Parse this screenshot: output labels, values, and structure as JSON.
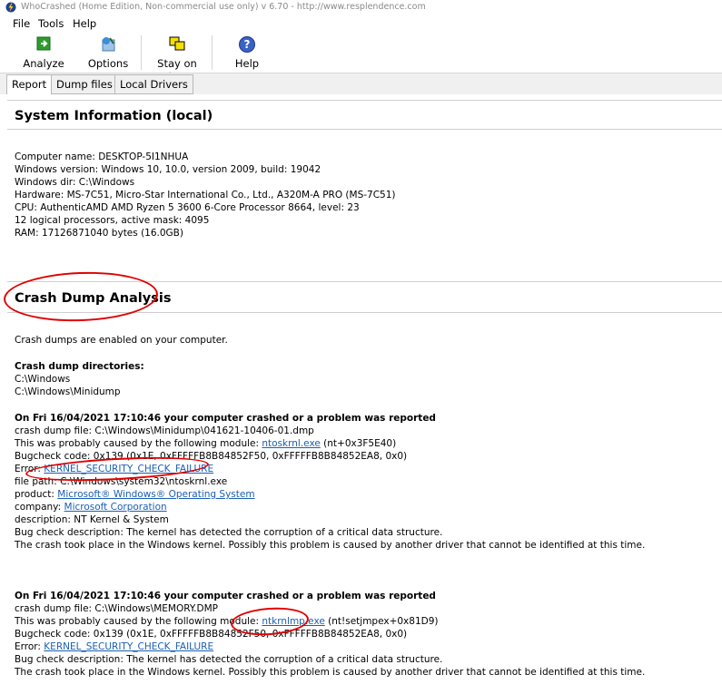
{
  "window": {
    "title": "WhoCrashed  (Home Edition, Non-commercial use only)  v 6.70  -   http://www.resplendence.com"
  },
  "menu": {
    "file": "File",
    "tools": "Tools",
    "help": "Help"
  },
  "toolbar": {
    "analyze": "Analyze",
    "options": "Options",
    "stay_on_top": "Stay on top",
    "help": "Help"
  },
  "tabs": [
    "Report",
    "Dump files",
    "Local Drivers"
  ],
  "sysinfo": {
    "heading": "System Information (local)",
    "lines": [
      "Computer name: DESKTOP-5I1NHUA",
      "Windows version: Windows 10, 10.0, version 2009, build: 19042",
      "Windows dir: C:\\Windows",
      "Hardware: MS-7C51, Micro-Star International Co., Ltd., A320M-A PRO (MS-7C51)",
      "CPU: AuthenticAMD AMD Ryzen 5 3600 6-Core Processor 8664, level: 23",
      "12 logical processors, active mask: 4095",
      "RAM: 17126871040 bytes (16.0GB)"
    ]
  },
  "crash": {
    "heading": "Crash Dump Analysis",
    "enabled": "Crash dumps are enabled on your computer.",
    "dirs_label": "Crash dump directories:",
    "dirs": [
      "C:\\Windows",
      "C:\\Windows\\Minidump"
    ],
    "events": [
      {
        "title": "On Fri 16/04/2021 17:10:46 your computer crashed or a problem was reported",
        "dump_file": "crash dump file: C:\\Windows\\Minidump\\041621-10406-01.dmp",
        "caused_prefix": "This was probably caused by the following module: ",
        "module": "ntoskrnl.exe",
        "module_suffix": " (nt+0x3F5E40)",
        "bugcheck": "Bugcheck code: 0x139 (0x1E, 0xFFFFFB8B84852F50, 0xFFFFFB8B84852EA8, 0x0)",
        "error_prefix": "Error: ",
        "error": "KERNEL_SECURITY_CHECK_FAILURE",
        "file_path": "file path: C:\\Windows\\system32\\ntoskrnl.exe",
        "product_prefix": "product: ",
        "product": "Microsoft® Windows® Operating System",
        "company_prefix": "company: ",
        "company": "Microsoft Corporation",
        "description": "description: NT Kernel & System",
        "bug_desc": "Bug check description: The kernel has detected the corruption of a critical data structure.",
        "place": "The crash took place in the Windows kernel. Possibly this problem is caused by another driver that cannot be identified at this time."
      },
      {
        "title": "On Fri 16/04/2021 17:10:46 your computer crashed or a problem was reported",
        "dump_file": "crash dump file: C:\\Windows\\MEMORY.DMP",
        "caused_prefix": "This was probably caused by the following module: ",
        "module": "ntkrnlmp.exe",
        "module_suffix": " (nt!setjmpex+0x81D9)",
        "bugcheck": "Bugcheck code: 0x139 (0x1E, 0xFFFFFB8B84852F50, 0xFFFFFB8B84852EA8, 0x0)",
        "error_prefix": "Error: ",
        "error": "KERNEL_SECURITY_CHECK_FAILURE",
        "bug_desc": "Bug check description: The kernel has detected the corruption of a critical data structure.",
        "place": "The crash took place in the Windows kernel. Possibly this problem is caused by another driver that cannot be identified at this time."
      }
    ]
  },
  "colors": {
    "link": "#1a5fb4",
    "annotation": "#e00000"
  }
}
